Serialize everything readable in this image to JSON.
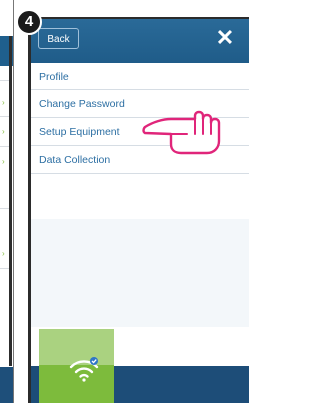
{
  "step_number": "4",
  "header": {
    "back_label": "Back",
    "close_glyph": "✕"
  },
  "menu": {
    "items": [
      {
        "label": "Profile"
      },
      {
        "label": "Change Password"
      },
      {
        "label": "Setup Equipment"
      },
      {
        "label": "Data Collection"
      }
    ]
  },
  "colors": {
    "header": "#1f5f8d",
    "menu_text": "#2d6fa3",
    "pointer": "#e0257a",
    "tile": "#7dbb3c",
    "bottom_bar": "#1d4d78"
  },
  "icons": [
    "hand-pointer-icon",
    "wifi-icon",
    "close-icon"
  ]
}
